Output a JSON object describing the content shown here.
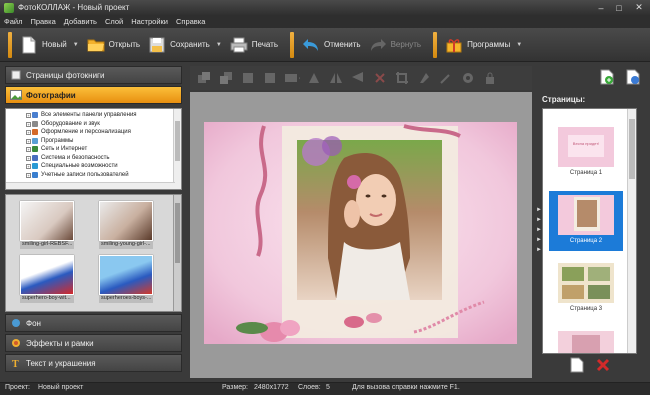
{
  "window": {
    "title": "ФотоКОЛЛАЖ - Новый проект"
  },
  "menu": [
    "Файл",
    "Правка",
    "Добавить",
    "Слой",
    "Настройки",
    "Справка"
  ],
  "toolbar": {
    "new_label": "Новый",
    "open_label": "Открыть",
    "save_label": "Сохранить",
    "print_label": "Печать",
    "undo_label": "Отменить",
    "redo_label": "Вернуть",
    "programs_label": "Программы"
  },
  "left": {
    "pages_photobook": "Страницы фотокниги",
    "photos": "Фотографии",
    "tree": [
      "Все элементы панели управления",
      "Оборудование и звук",
      "Оформление и персонализация",
      "Программы",
      "Сеть и Интернет",
      "Система и безопасность",
      "Специальные возможности",
      "Учетные записи пользователей"
    ],
    "thumbs": [
      "smiling-girl-REBSF...",
      "smiling-young-girl-...",
      "superhero-boy-wit...",
      "superheroes-boys-..."
    ],
    "background": "Фон",
    "effects": "Эффекты и рамки",
    "text": "Текст и украшения"
  },
  "right": {
    "pages_title": "Страницы:",
    "pages": [
      "Страница 1",
      "Страница 2",
      "Страница 3"
    ],
    "page1_caption": "Весна придет!"
  },
  "status": {
    "project_label": "Проект:",
    "project_value": "Новый проект",
    "size_label": "Размер:",
    "size_value": "2480x1772",
    "layers_label": "Слоев:",
    "layers_value": "5",
    "help_text": "Для вызова справки нажмите F1."
  }
}
